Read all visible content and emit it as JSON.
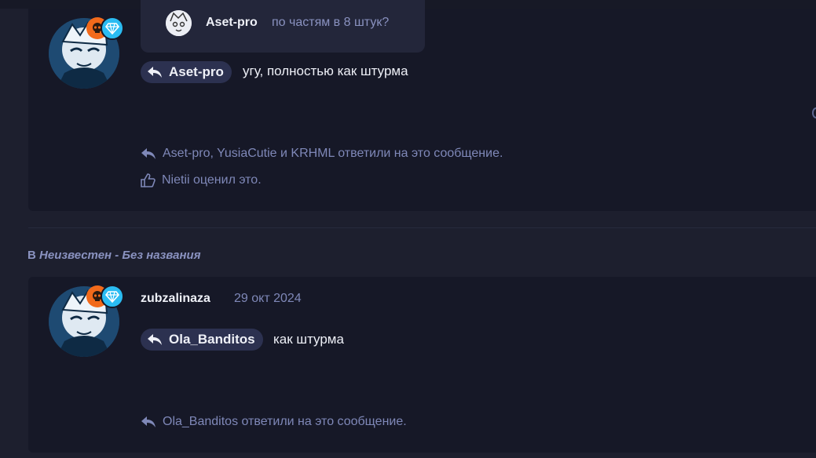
{
  "post1": {
    "quote": {
      "username": "Aset-pro",
      "text": "по частям в 8 штук?"
    },
    "mention": "Aset-pro",
    "message": "угу, полностью как штурма",
    "replies_text": "Aset-pro, YusiaCutie и KRHML ответили на это сообщение.",
    "likes_text": "Nietii оценил это."
  },
  "thread": {
    "prefix": "В",
    "name": "Неизвестен - Без названия"
  },
  "post2": {
    "author": "zubzalinaza",
    "date": "29 окт 2024",
    "mention": "Ola_Banditos",
    "message": "как штурма",
    "replies_text": "Ola_Banditos ответили на это сообщение."
  },
  "colors": {
    "background": "#1d1f2e",
    "card": "#161827",
    "muted_text": "#7f88b8",
    "badge_orange": "#f26a1b",
    "badge_cyan": "#2bbcf2"
  },
  "icons": [
    "reply-icon",
    "like-icon",
    "gem-icon",
    "skull-icon"
  ]
}
